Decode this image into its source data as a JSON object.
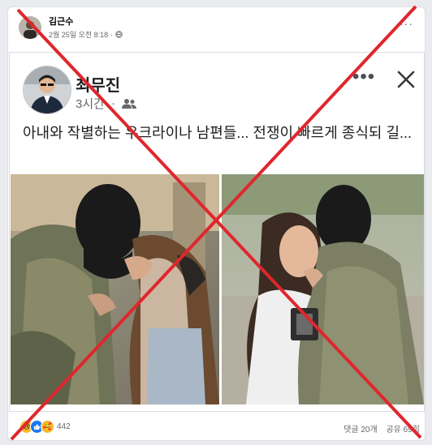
{
  "outer_post": {
    "author": "김근수",
    "timestamp": "2월 25일 오전 8:18",
    "privacy_icon": "globe-icon",
    "more_icon": "more-dots-icon"
  },
  "shared_post": {
    "author": "최무진",
    "time": "3시간",
    "audience_icon": "friends-icon",
    "more_icon": "more-dots-icon",
    "close_icon": "close-icon",
    "text": "아내와 작별하는 우크라이나 남편들... 전쟁이 빠르게 종식되 길..."
  },
  "footer": {
    "reactions": [
      "sad",
      "like",
      "care"
    ],
    "reaction_count": "442",
    "comments": "댓글 20개",
    "shares": "공유 69회"
  },
  "overlay": {
    "mark": "red-x",
    "color": "#e0262d"
  }
}
